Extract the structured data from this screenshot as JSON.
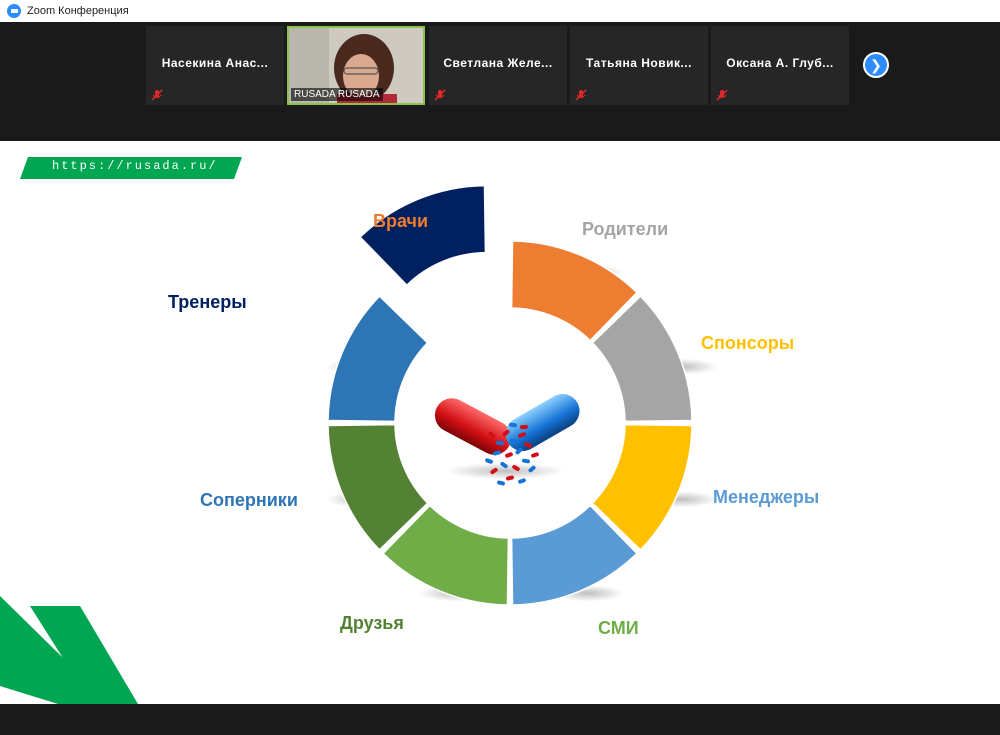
{
  "window": {
    "title": "Zoom Конференция"
  },
  "participants": [
    {
      "name": "Насекина  Анас..."
    },
    {
      "name": "RUSADA RUSADA"
    },
    {
      "name": "Светлана  Желе..."
    },
    {
      "name": "Татьяна  Новик..."
    },
    {
      "name": "Оксана  А.  Глуб..."
    }
  ],
  "slide": {
    "url": "https://rusada.ru/",
    "labels": {
      "vrachi": "Врачи",
      "roditeli": "Родители",
      "trenery": "Тренеры",
      "sponsory": "Спонсоры",
      "menedzhery": "Менеджеры",
      "soperniki": "Соперники",
      "druzya": "Друзья",
      "smi": "СМИ"
    },
    "colors": {
      "vrachi": "#ed7d31",
      "roditeli": "#a5a5a5",
      "trenery": "#002060",
      "sponsory": "#ffc000",
      "menedzhery": "#5b9bd5",
      "soperniki": "#2e75b6",
      "druzya": "#548235",
      "smi": "#70ad47"
    }
  }
}
